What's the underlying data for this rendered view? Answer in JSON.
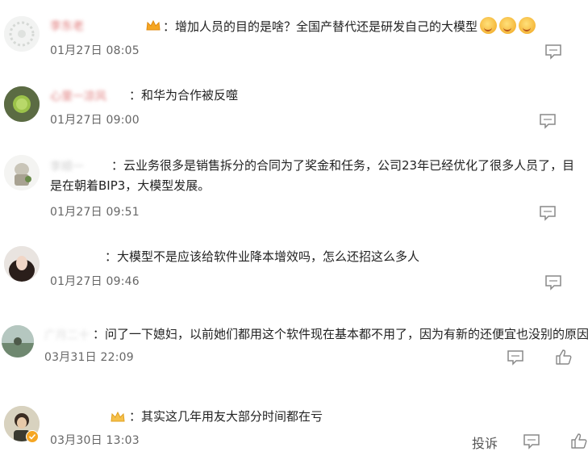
{
  "comments": [
    {
      "name": "李东老",
      "text": "：增加人员的目的是啥？全国产替代还是研发自己的大模型",
      "emoji_count": 3,
      "time": "01月27日 08:05"
    },
    {
      "name": "心里一凉风",
      "text": "：和华为合作被反噬",
      "time": "01月27日 09:00"
    },
    {
      "name": "李顺一",
      "text_line1": "：云业务很多是销售拆分的合同为了奖金和任务，公司23年已经优化了很多人员了，目",
      "text_line2": "是在朝着BIP3，大模型发展。",
      "time": "01月27日 09:51"
    },
    {
      "name": "",
      "text": "：大模型不是应该给软件业降本增效吗，怎么还招这么多人",
      "time": "01月27日 09:46"
    },
    {
      "name": "广月二十",
      "text": "：问了一下媳妇，以前她们都用这个软件现在基本都不用了，因为有新的还便宜也没别的原因。",
      "time": "03月31日 22:09"
    },
    {
      "name": "",
      "text": "：其实这几年用友大部分时间都在亏",
      "time": "03月30日 13:03",
      "report_label": "投诉"
    }
  ],
  "icons": {
    "comment": "comment-icon",
    "like": "thumbs-up-icon",
    "crown": "crown-icon",
    "verified": "verified-badge-icon"
  },
  "colors": {
    "accent_badge": "#f5a623",
    "time_text": "#666666",
    "icon_gray": "#888888"
  }
}
